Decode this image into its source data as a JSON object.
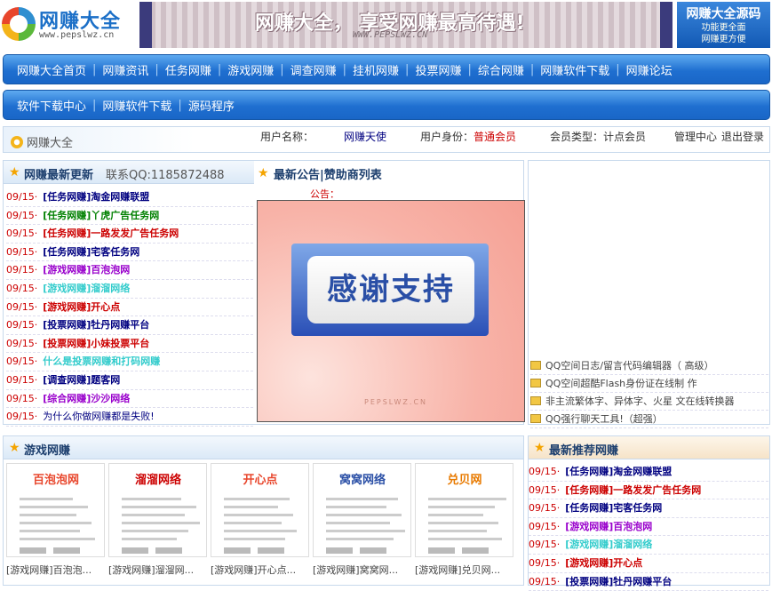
{
  "header": {
    "logo_text": "网赚大全",
    "logo_url": "www.pepslwz.cn",
    "banner_text": "网赚大全， 享受网赚最高待遇!",
    "banner_sub": "WWW.PEPSLWZ.CN",
    "source_title": "网赚大全源码",
    "source_line1": "功能更全面",
    "source_line2": "网赚更方便"
  },
  "nav1": [
    "网赚大全首页",
    "网赚资讯",
    "任务网赚",
    "游戏网赚",
    "调查网赚",
    "挂机网赚",
    "投票网赚",
    "综合网赚",
    "网赚软件下载",
    "网赚论坛"
  ],
  "nav2": [
    "软件下载中心",
    "网赚软件下载",
    "源码程序"
  ],
  "userbar": {
    "home": "网赚大全",
    "username_label": "用户名称：",
    "username": "网赚天使",
    "identity_label": "用户身份：",
    "identity": "普通会员",
    "type_label": "会员类型：",
    "type": "计点会员",
    "admin": "管理中心",
    "logout": "退出登录"
  },
  "updates": {
    "title": "网赚最新更新",
    "contact": "联系QQ:1185872488",
    "items": [
      {
        "date": "09/15·",
        "text": "[任务网赚]淘金网赚联盟",
        "color": "#000080",
        "bold": true
      },
      {
        "date": "09/15·",
        "text": "[任务网赚]丫虎广告任务网",
        "color": "#008000",
        "bold": true
      },
      {
        "date": "09/15·",
        "text": "[任务网赚]一路发发广告任务网",
        "color": "#cc0000",
        "bold": true
      },
      {
        "date": "09/15·",
        "text": "[任务网赚]宅客任务网",
        "color": "#000080",
        "bold": true
      },
      {
        "date": "09/15·",
        "text": "[游戏网赚]百泡泡网",
        "color": "#9900cc",
        "bold": true
      },
      {
        "date": "09/15·",
        "text": "[游戏网赚]溜溜网络",
        "color": "#33cccc",
        "bold": true
      },
      {
        "date": "09/15·",
        "text": "[游戏网赚]开心点",
        "color": "#cc0000",
        "bold": true
      },
      {
        "date": "09/15·",
        "text": "[投票网赚]牡丹网赚平台",
        "color": "#000080",
        "bold": true
      },
      {
        "date": "09/15·",
        "text": "[投票网赚]小妹投票平台",
        "color": "#cc0000",
        "bold": true
      },
      {
        "date": "09/15·",
        "text": "什么是投票网赚和打码网赚",
        "color": "#33cccc",
        "bold": true
      },
      {
        "date": "09/15·",
        "text": "[调查网赚]题客网",
        "color": "#000080",
        "bold": true
      },
      {
        "date": "09/15·",
        "text": "[综合网赚]沙沙网络",
        "color": "#9900cc",
        "bold": true
      },
      {
        "date": "09/15·",
        "text": "为什么你做网赚都是失败!",
        "color": "#000080",
        "bold": false
      }
    ]
  },
  "notice": {
    "title": "最新公告|赞助商列表",
    "label": "公告：",
    "image_text": "感谢支持",
    "watermark": "PEPSLWZ.CN"
  },
  "right_links": [
    "QQ空间日志/留言代码编辑器（ 高级）",
    "QQ空间超酷Flash身份证在线制 作",
    "非主流繁体字、异体字、火星 文在线转换器",
    "QQ强行聊天工具!（超强）"
  ],
  "games": {
    "title": "游戏网赚",
    "cards": [
      {
        "logo": "百泡泡网",
        "logo_color": "#e8462c",
        "caption": "[游戏网赚]百泡泡..."
      },
      {
        "logo": "溜溜网络",
        "logo_color": "#cc0000",
        "caption": "[游戏网赚]溜溜网..."
      },
      {
        "logo": "开心点",
        "logo_color": "#e8462c",
        "caption": "[游戏网赚]开心点..."
      },
      {
        "logo": "窝窝网络",
        "logo_color": "#2a4fa6",
        "caption": "[游戏网赚]窝窝网..."
      },
      {
        "logo": "兑贝网",
        "logo_color": "#e87a00",
        "caption": "[游戏网赚]兑贝网..."
      }
    ]
  },
  "recommend": {
    "title": "最新推荐网赚",
    "items": [
      {
        "date": "09/15·",
        "text": "[任务网赚]淘金网赚联盟",
        "color": "#000080"
      },
      {
        "date": "09/15·",
        "text": "[任务网赚]一路发发广告任务网",
        "color": "#cc0000"
      },
      {
        "date": "09/15·",
        "text": "[任务网赚]宅客任务网",
        "color": "#000080"
      },
      {
        "date": "09/15·",
        "text": "[游戏网赚]百泡泡网",
        "color": "#9900cc"
      },
      {
        "date": "09/15·",
        "text": "[游戏网赚]溜溜网络",
        "color": "#33cccc"
      },
      {
        "date": "09/15·",
        "text": "[游戏网赚]开心点",
        "color": "#cc0000"
      },
      {
        "date": "09/15·",
        "text": "[投票网赚]牡丹网赚平台",
        "color": "#000080"
      }
    ]
  }
}
